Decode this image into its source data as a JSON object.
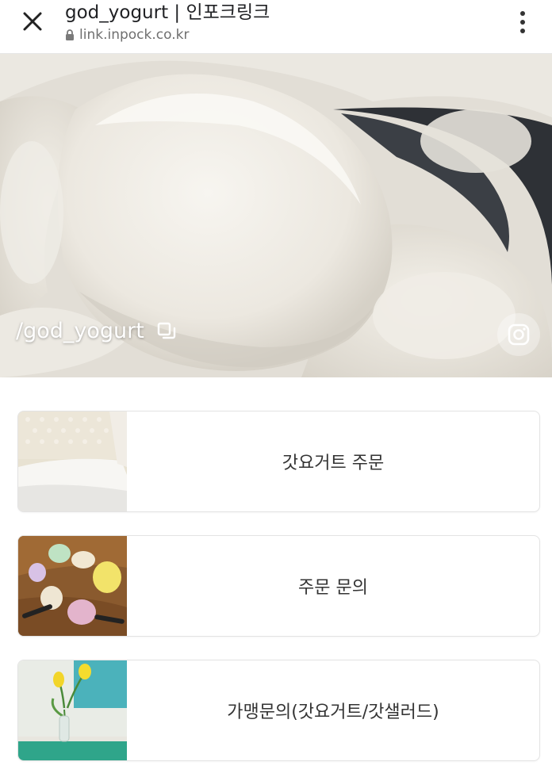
{
  "browser": {
    "title": "god_yogurt | 인포크링크",
    "url": "link.inpock.co.kr",
    "icons": {
      "close": "close-icon",
      "lock": "lock-icon",
      "menu": "more-vertical-icon"
    }
  },
  "profile": {
    "handle": "/god_yogurt",
    "icons": {
      "copy": "copy-icon",
      "instagram": "instagram-icon"
    }
  },
  "links": [
    {
      "label": "갓요거트 주문",
      "thumb": "greek-yogurt-block-photo"
    },
    {
      "label": "주문 문의",
      "thumb": "colored-yogurt-scoops-photo"
    },
    {
      "label": "가맹문의(갓요거트/갓샐러드)",
      "thumb": "yellow-tulip-vase-photo"
    }
  ],
  "colors": {
    "text": "#333333",
    "card_border": "#e3e3e3",
    "url_gray": "#6f6f6f"
  }
}
